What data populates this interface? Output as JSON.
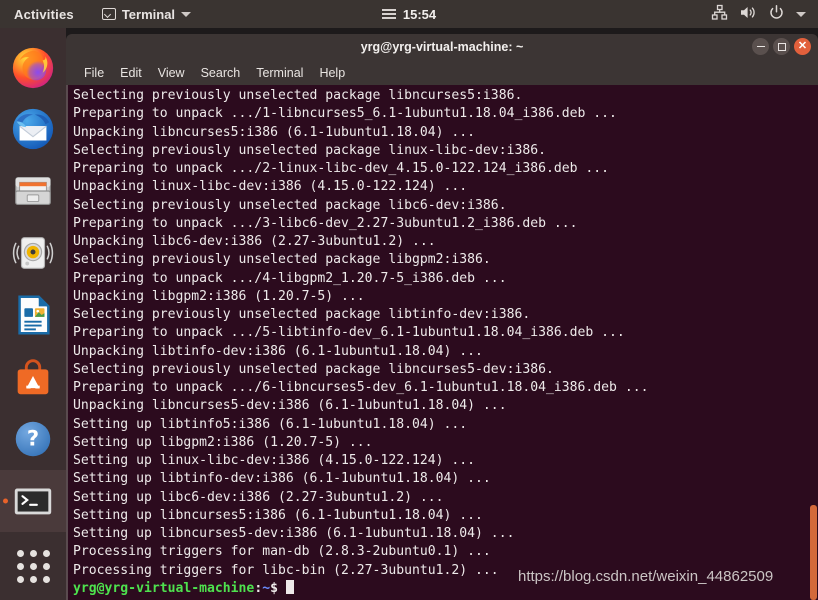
{
  "topbar": {
    "activities": "Activities",
    "app_name": "Terminal",
    "app_icon": "terminal-icon",
    "clock": "15:54",
    "calendar_icon": "hamburger-icon",
    "network_icon": "network-icon",
    "volume_icon": "volume-icon",
    "power_icon": "power-icon",
    "menu_caret_icon": "chevron-down-icon",
    "bg": "#3a3431"
  },
  "dock": {
    "bg": "#3b2f30",
    "running_indicator_color": "#e8622a",
    "items": [
      {
        "name": "firefox",
        "label": "Firefox",
        "icon": "firefox-icon",
        "running": false
      },
      {
        "name": "thunderbird",
        "label": "Thunderbird Mail",
        "icon": "thunderbird-icon",
        "running": false
      },
      {
        "name": "files",
        "label": "Files",
        "icon": "files-icon",
        "running": false
      },
      {
        "name": "rhythmbox",
        "label": "Rhythmbox",
        "icon": "rhythmbox-icon",
        "running": false
      },
      {
        "name": "libreoffice-writer",
        "label": "LibreOffice Writer",
        "icon": "libreoffice-writer-icon",
        "running": false
      },
      {
        "name": "ubuntu-software",
        "label": "Ubuntu Software",
        "icon": "ubuntu-software-icon",
        "running": false
      },
      {
        "name": "help",
        "label": "Help",
        "icon": "help-icon",
        "running": false
      },
      {
        "name": "terminal",
        "label": "Terminal",
        "icon": "terminal-icon",
        "running": true
      }
    ],
    "show_applications": "Show Applications",
    "show_applications_icon": "grid-icon"
  },
  "terminal": {
    "title": "yrg@yrg-virtual-machine: ~",
    "bg": "#2c0b1e",
    "fg": "#eeeaea",
    "titlebar_bg": "#3c3534",
    "scrollbar_color": "#d3693a",
    "window_buttons": {
      "minimize": "minimize-button",
      "maximize": "maximize-button",
      "close": "close-button"
    },
    "menu": [
      "File",
      "Edit",
      "View",
      "Search",
      "Terminal",
      "Help"
    ],
    "lines": [
      "Selecting previously unselected package libncurses5:i386.",
      "Preparing to unpack .../1-libncurses5_6.1-1ubuntu1.18.04_i386.deb ...",
      "Unpacking libncurses5:i386 (6.1-1ubuntu1.18.04) ...",
      "Selecting previously unselected package linux-libc-dev:i386.",
      "Preparing to unpack .../2-linux-libc-dev_4.15.0-122.124_i386.deb ...",
      "Unpacking linux-libc-dev:i386 (4.15.0-122.124) ...",
      "Selecting previously unselected package libc6-dev:i386.",
      "Preparing to unpack .../3-libc6-dev_2.27-3ubuntu1.2_i386.deb ...",
      "Unpacking libc6-dev:i386 (2.27-3ubuntu1.2) ...",
      "Selecting previously unselected package libgpm2:i386.",
      "Preparing to unpack .../4-libgpm2_1.20.7-5_i386.deb ...",
      "Unpacking libgpm2:i386 (1.20.7-5) ...",
      "Selecting previously unselected package libtinfo-dev:i386.",
      "Preparing to unpack .../5-libtinfo-dev_6.1-1ubuntu1.18.04_i386.deb ...",
      "Unpacking libtinfo-dev:i386 (6.1-1ubuntu1.18.04) ...",
      "Selecting previously unselected package libncurses5-dev:i386.",
      "Preparing to unpack .../6-libncurses5-dev_6.1-1ubuntu1.18.04_i386.deb ...",
      "Unpacking libncurses5-dev:i386 (6.1-1ubuntu1.18.04) ...",
      "Setting up libtinfo5:i386 (6.1-1ubuntu1.18.04) ...",
      "Setting up libgpm2:i386 (1.20.7-5) ...",
      "Setting up linux-libc-dev:i386 (4.15.0-122.124) ...",
      "Setting up libtinfo-dev:i386 (6.1-1ubuntu1.18.04) ...",
      "Setting up libc6-dev:i386 (2.27-3ubuntu1.2) ...",
      "Setting up libncurses5:i386 (6.1-1ubuntu1.18.04) ...",
      "Setting up libncurses5-dev:i386 (6.1-1ubuntu1.18.04) ...",
      "Processing triggers for man-db (2.8.3-2ubuntu0.1) ...",
      "Processing triggers for libc-bin (2.27-3ubuntu1.2) ..."
    ],
    "prompt": {
      "user_host": "yrg@yrg-virtual-machine",
      "colon": ":",
      "path": "~",
      "sigil": "$",
      "user_host_color": "#4ee24e",
      "path_color": "#6a8cff"
    }
  },
  "watermark": "https://blog.csdn.net/weixin_44862509"
}
